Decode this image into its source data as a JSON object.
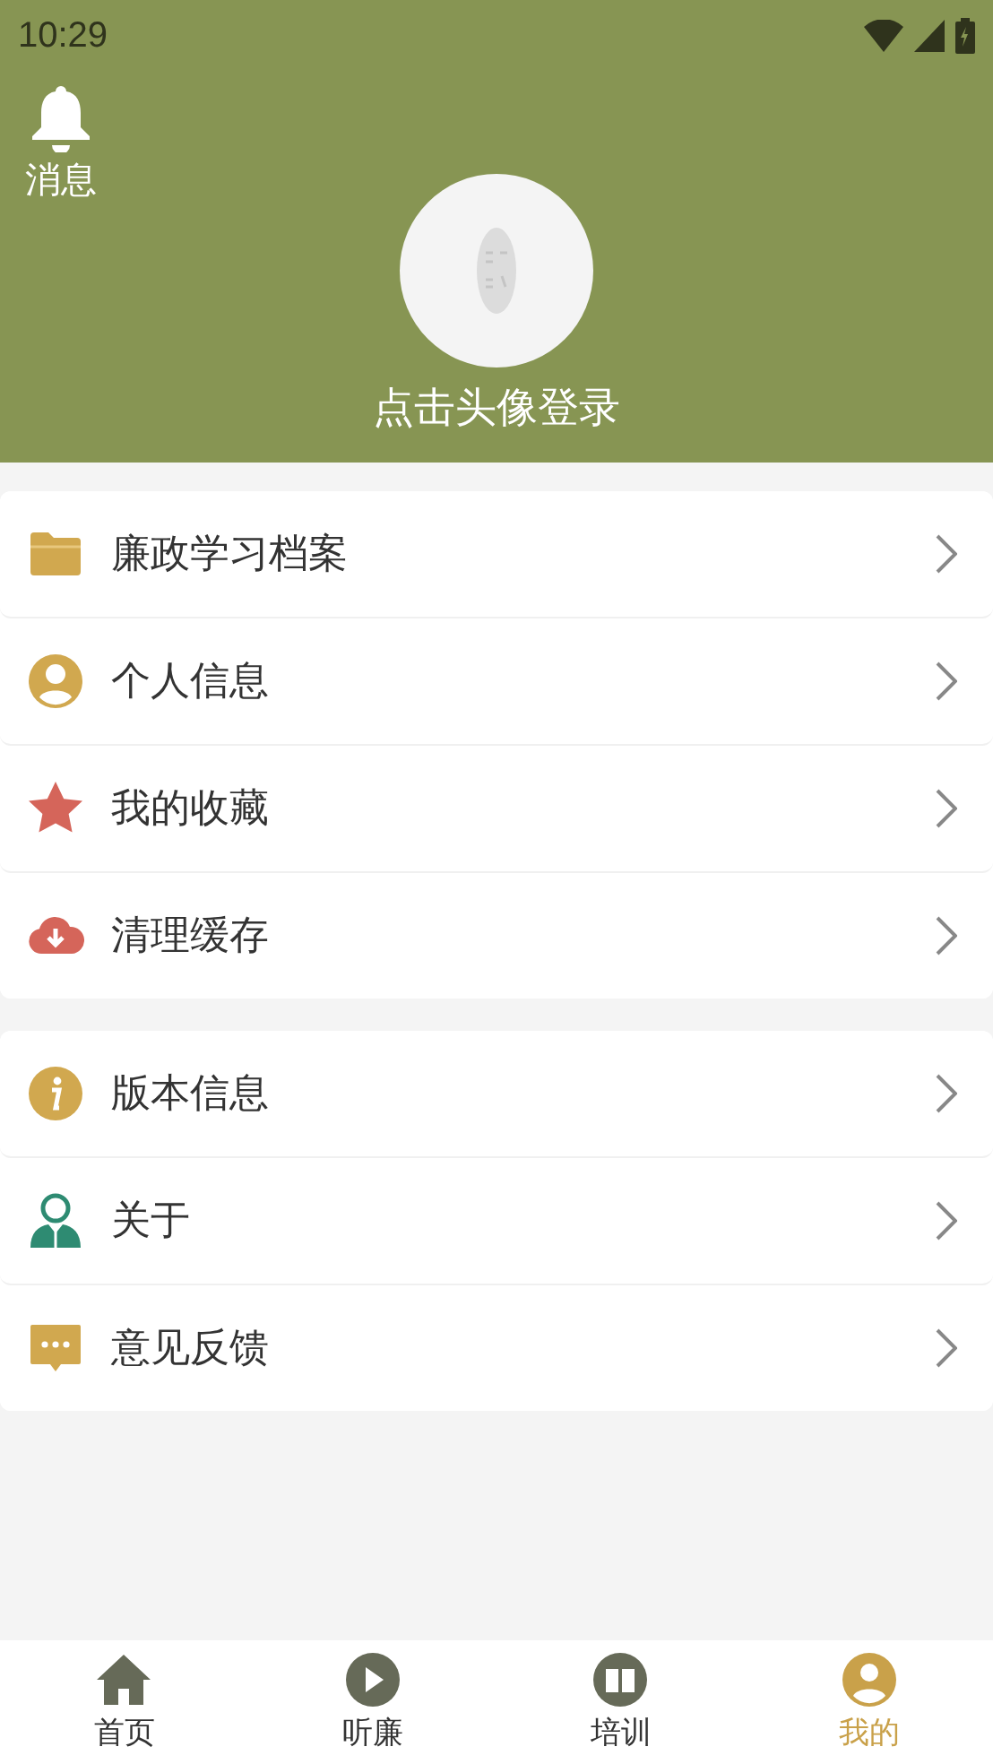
{
  "status_bar": {
    "time": "10:29"
  },
  "header": {
    "messages_label": "消息",
    "login_prompt": "点击头像登录"
  },
  "menu_groups": [
    {
      "items": [
        {
          "kind": "folder",
          "label": "廉政学习档案"
        },
        {
          "kind": "person",
          "label": "个人信息"
        },
        {
          "kind": "star",
          "label": "我的收藏"
        },
        {
          "kind": "cloud",
          "label": "清理缓存"
        }
      ]
    },
    {
      "items": [
        {
          "kind": "info",
          "label": "版本信息"
        },
        {
          "kind": "about",
          "label": "关于"
        },
        {
          "kind": "chat",
          "label": "意见反馈"
        }
      ]
    }
  ],
  "bottom_nav": [
    {
      "kind": "home",
      "label": "首页",
      "selected": false
    },
    {
      "kind": "play",
      "label": "听廉",
      "selected": false
    },
    {
      "kind": "train",
      "label": "培训",
      "selected": false
    },
    {
      "kind": "me",
      "label": "我的",
      "selected": true
    }
  ]
}
